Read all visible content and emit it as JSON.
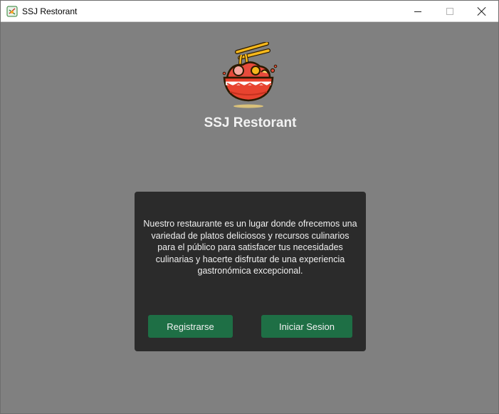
{
  "window": {
    "title": "SSJ Restorant",
    "controls": {
      "minimize": "minimize-icon",
      "maximize": "maximize-icon",
      "close": "close-icon"
    }
  },
  "header": {
    "logo_icon": "ramen-bowl-icon",
    "title": "SSJ Restorant"
  },
  "card": {
    "description": "Nuestro restaurante es un lugar donde ofrecemos una variedad de platos deliciosos y recursos culinarios para el público para satisfacer tus necesidades culinarias y hacerte disfrutar de una experiencia gastronómica excepcional.",
    "register_label": "Registrarse",
    "login_label": "Iniciar Sesion"
  },
  "colors": {
    "background": "#808080",
    "card": "#2b2b2b",
    "button": "#1e6f45",
    "text": "#f2f2f2"
  }
}
